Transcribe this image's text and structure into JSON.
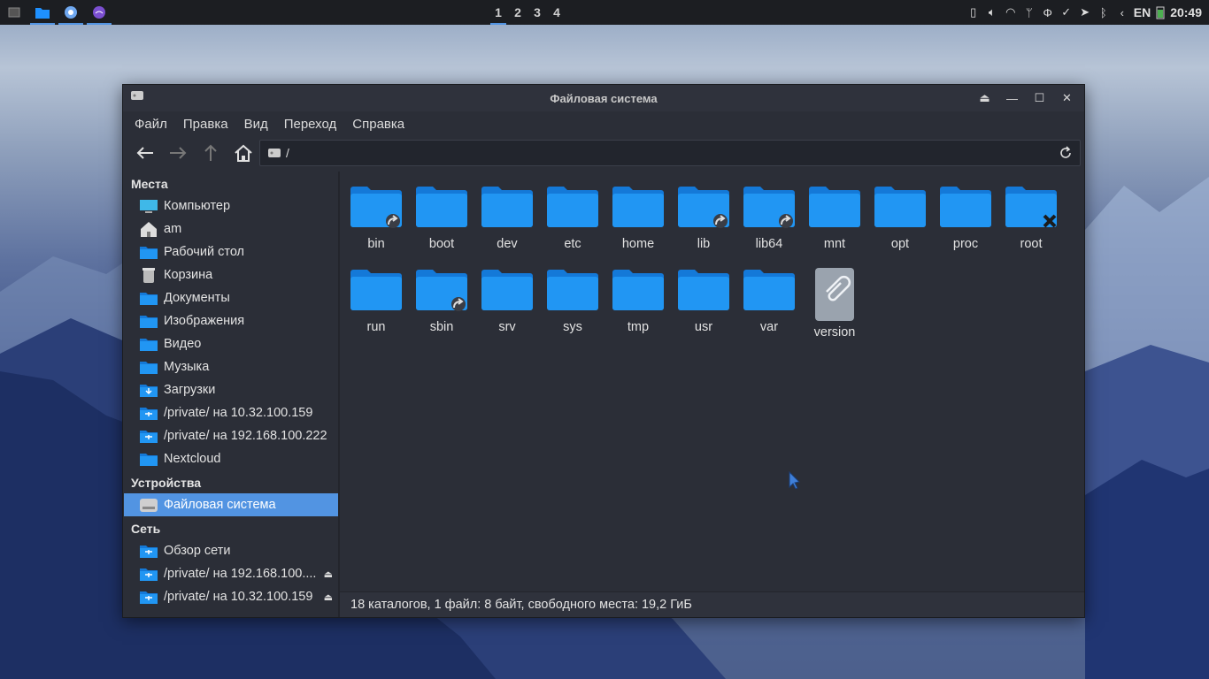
{
  "panel": {
    "desktops": [
      "1",
      "2",
      "3",
      "4"
    ],
    "current_desktop": "1",
    "language": "EN",
    "clock": "20:49"
  },
  "window": {
    "title": "Файловая система",
    "menu": [
      "Файл",
      "Правка",
      "Вид",
      "Переход",
      "Справка"
    ],
    "path": "/",
    "sidebar": {
      "places_header": "Места",
      "places": [
        {
          "label": "Компьютер",
          "icon": "computer-icon"
        },
        {
          "label": "am",
          "icon": "home-icon"
        },
        {
          "label": "Рабочий стол",
          "icon": "desktop-folder-icon"
        },
        {
          "label": "Корзина",
          "icon": "trash-icon"
        },
        {
          "label": "Документы",
          "icon": "documents-folder-icon"
        },
        {
          "label": "Изображения",
          "icon": "pictures-folder-icon"
        },
        {
          "label": "Видео",
          "icon": "videos-folder-icon"
        },
        {
          "label": "Музыка",
          "icon": "music-folder-icon"
        },
        {
          "label": "Загрузки",
          "icon": "downloads-folder-icon"
        },
        {
          "label": "/private/ на 10.32.100.159",
          "icon": "network-folder-icon"
        },
        {
          "label": "/private/ на 192.168.100.222",
          "icon": "network-folder-icon"
        },
        {
          "label": "Nextcloud",
          "icon": "folder-icon"
        }
      ],
      "devices_header": "Устройства",
      "devices": [
        {
          "label": "Файловая система",
          "icon": "drive-icon",
          "selected": true
        }
      ],
      "network_header": "Сеть",
      "network": [
        {
          "label": "Обзор сети",
          "icon": "network-folder-icon"
        },
        {
          "label": "/private/ на 192.168.100....",
          "icon": "network-folder-icon",
          "eject": true
        },
        {
          "label": "/private/ на 10.32.100.159",
          "icon": "network-folder-icon",
          "eject": true
        }
      ]
    },
    "items": [
      {
        "name": "bin",
        "kind": "link"
      },
      {
        "name": "boot",
        "kind": "folder"
      },
      {
        "name": "dev",
        "kind": "folder"
      },
      {
        "name": "etc",
        "kind": "folder"
      },
      {
        "name": "home",
        "kind": "folder"
      },
      {
        "name": "lib",
        "kind": "link"
      },
      {
        "name": "lib64",
        "kind": "link"
      },
      {
        "name": "mnt",
        "kind": "folder"
      },
      {
        "name": "opt",
        "kind": "folder"
      },
      {
        "name": "proc",
        "kind": "folder"
      },
      {
        "name": "root",
        "kind": "locked"
      },
      {
        "name": "run",
        "kind": "folder"
      },
      {
        "name": "sbin",
        "kind": "link"
      },
      {
        "name": "srv",
        "kind": "folder"
      },
      {
        "name": "sys",
        "kind": "folder"
      },
      {
        "name": "tmp",
        "kind": "folder"
      },
      {
        "name": "usr",
        "kind": "folder"
      },
      {
        "name": "var",
        "kind": "folder"
      },
      {
        "name": "version",
        "kind": "file"
      }
    ],
    "status": "18 каталогов, 1 файл: 8 байт, свободного места: 19,2 ГиБ"
  },
  "colors": {
    "accent": "#5294e2",
    "folder": "#1e90ff",
    "window_bg": "#2b2e37",
    "panel_bg": "#1c1e22"
  }
}
